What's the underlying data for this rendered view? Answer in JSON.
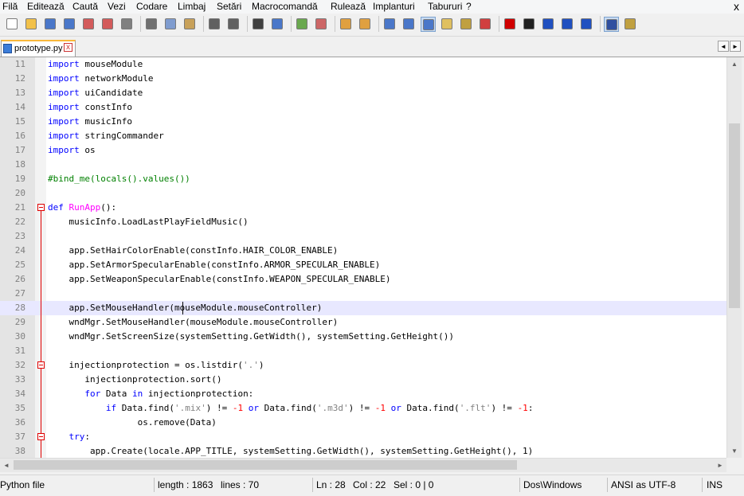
{
  "menu": [
    "Filă",
    "Editează",
    "Caută",
    "Vezi",
    "Codare",
    "Limbaj",
    "Setări",
    "Macrocomandă",
    "Rulează",
    "Implanturi",
    "Tabururi",
    "?"
  ],
  "menu_close": "x",
  "toolbar": [
    {
      "name": "new-file-icon",
      "color": "#ffffff"
    },
    {
      "name": "open-file-icon",
      "color": "#f2c14a"
    },
    {
      "name": "save-icon",
      "color": "#4a77c9"
    },
    {
      "name": "save-all-icon",
      "color": "#4a77c9"
    },
    {
      "name": "close-file-icon",
      "color": "#d35b5b"
    },
    {
      "name": "close-all-icon",
      "color": "#d35b5b"
    },
    {
      "name": "print-icon",
      "color": "#808080"
    },
    {
      "name": "sep"
    },
    {
      "name": "cut-icon",
      "color": "#707070"
    },
    {
      "name": "copy-icon",
      "color": "#7f9ccf"
    },
    {
      "name": "paste-icon",
      "color": "#c8a15a"
    },
    {
      "name": "sep"
    },
    {
      "name": "undo-icon",
      "color": "#606060"
    },
    {
      "name": "redo-icon",
      "color": "#606060"
    },
    {
      "name": "sep"
    },
    {
      "name": "find-icon",
      "color": "#404040"
    },
    {
      "name": "replace-icon",
      "color": "#4a77c9"
    },
    {
      "name": "sep"
    },
    {
      "name": "zoom-in-icon",
      "color": "#6aa84f"
    },
    {
      "name": "zoom-out-icon",
      "color": "#cc6666"
    },
    {
      "name": "sep"
    },
    {
      "name": "sync-vertical-icon",
      "color": "#e0a040"
    },
    {
      "name": "sync-horizontal-icon",
      "color": "#e0a040"
    },
    {
      "name": "sep"
    },
    {
      "name": "word-wrap-icon",
      "color": "#4a77c9"
    },
    {
      "name": "show-all-chars-icon",
      "color": "#4a77c9"
    },
    {
      "name": "indent-guide-icon",
      "color": "#4a77c9",
      "active": true
    },
    {
      "name": "doc-map-icon",
      "color": "#e0c060"
    },
    {
      "name": "function-list-icon",
      "color": "#c0a040"
    },
    {
      "name": "folder-workspace-icon",
      "color": "#d04040"
    },
    {
      "name": "sep"
    },
    {
      "name": "record-macro-icon",
      "color": "#d00000"
    },
    {
      "name": "stop-macro-icon",
      "color": "#202020"
    },
    {
      "name": "play-macro-icon",
      "color": "#2050c0"
    },
    {
      "name": "play-multiple-icon",
      "color": "#2050c0"
    },
    {
      "name": "save-macro-icon",
      "color": "#2050c0"
    },
    {
      "name": "sep"
    },
    {
      "name": "spellcheck-icon",
      "color": "#3050a0",
      "active": true
    },
    {
      "name": "plugin-icon",
      "color": "#c0a040"
    }
  ],
  "tab": {
    "label": "prototype.py",
    "close": "x"
  },
  "tab_arrows": [
    "◄",
    "►"
  ],
  "editor": {
    "lines": [
      {
        "n": "11",
        "segs": [
          {
            "c": "kw2",
            "t": "import"
          },
          {
            "c": "",
            "t": " mouseModule"
          }
        ]
      },
      {
        "n": "12",
        "segs": [
          {
            "c": "kw2",
            "t": "import"
          },
          {
            "c": "",
            "t": " networkModule"
          }
        ]
      },
      {
        "n": "13",
        "segs": [
          {
            "c": "kw2",
            "t": "import"
          },
          {
            "c": "",
            "t": " uiCandidate"
          }
        ]
      },
      {
        "n": "14",
        "segs": [
          {
            "c": "kw2",
            "t": "import"
          },
          {
            "c": "",
            "t": " constInfo"
          }
        ]
      },
      {
        "n": "15",
        "segs": [
          {
            "c": "kw2",
            "t": "import"
          },
          {
            "c": "",
            "t": " musicInfo"
          }
        ]
      },
      {
        "n": "16",
        "segs": [
          {
            "c": "kw2",
            "t": "import"
          },
          {
            "c": "",
            "t": " stringCommander"
          }
        ]
      },
      {
        "n": "17",
        "segs": [
          {
            "c": "kw2",
            "t": "import"
          },
          {
            "c": "",
            "t": " os"
          }
        ]
      },
      {
        "n": "18",
        "segs": []
      },
      {
        "n": "19",
        "segs": [
          {
            "c": "cm",
            "t": "#bind_me(locals().values())"
          }
        ]
      },
      {
        "n": "20",
        "segs": []
      },
      {
        "n": "21",
        "segs": [
          {
            "c": "kw2",
            "t": "def"
          },
          {
            "c": "",
            "t": " "
          },
          {
            "c": "fn",
            "t": "RunApp"
          },
          {
            "c": "",
            "t": "():"
          }
        ]
      },
      {
        "n": "22",
        "segs": [
          {
            "c": "",
            "t": "    musicInfo.LoadLastPlayFieldMusic()"
          }
        ]
      },
      {
        "n": "23",
        "segs": []
      },
      {
        "n": "24",
        "segs": [
          {
            "c": "",
            "t": "    app.SetHairColorEnable(constInfo.HAIR_COLOR_ENABLE)"
          }
        ]
      },
      {
        "n": "25",
        "segs": [
          {
            "c": "",
            "t": "    app.SetArmorSpecularEnable(constInfo.ARMOR_SPECULAR_ENABLE)"
          }
        ]
      },
      {
        "n": "26",
        "segs": [
          {
            "c": "",
            "t": "    app.SetWeaponSpecularEnable(constInfo.WEAPON_SPECULAR_ENABLE)"
          }
        ]
      },
      {
        "n": "27",
        "segs": []
      },
      {
        "n": "28",
        "segs": [
          {
            "c": "",
            "t": "    app.SetMouseHandler(mouseModule.mouseController)"
          }
        ]
      },
      {
        "n": "29",
        "segs": [
          {
            "c": "",
            "t": "    wndMgr.SetMouseHandler(mouseModule.mouseController)"
          }
        ]
      },
      {
        "n": "30",
        "segs": [
          {
            "c": "",
            "t": "    wndMgr.SetScreenSize(systemSetting.GetWidth(), systemSetting.GetHeight())"
          }
        ]
      },
      {
        "n": "31",
        "segs": []
      },
      {
        "n": "32",
        "segs": [
          {
            "c": "",
            "t": "    injectionprotection = os.listdir("
          },
          {
            "c": "st",
            "t": "'.'"
          },
          {
            "c": "",
            "t": ")"
          }
        ]
      },
      {
        "n": "33",
        "segs": [
          {
            "c": "",
            "t": "       injectionprotection.sort()"
          }
        ]
      },
      {
        "n": "34",
        "segs": [
          {
            "c": "",
            "t": "       "
          },
          {
            "c": "kw2",
            "t": "for"
          },
          {
            "c": "",
            "t": " Data "
          },
          {
            "c": "kw2",
            "t": "in"
          },
          {
            "c": "",
            "t": " injectionprotection:"
          }
        ]
      },
      {
        "n": "35",
        "segs": [
          {
            "c": "",
            "t": "           "
          },
          {
            "c": "kw2",
            "t": "if"
          },
          {
            "c": "",
            "t": " Data.find("
          },
          {
            "c": "st",
            "t": "'.mix'"
          },
          {
            "c": "",
            "t": ") != "
          },
          {
            "c": "nm",
            "t": "-1"
          },
          {
            "c": "",
            "t": " "
          },
          {
            "c": "kw2",
            "t": "or"
          },
          {
            "c": "",
            "t": " Data.find("
          },
          {
            "c": "st",
            "t": "'.m3d'"
          },
          {
            "c": "",
            "t": ") != "
          },
          {
            "c": "nm",
            "t": "-1"
          },
          {
            "c": "",
            "t": " "
          },
          {
            "c": "kw2",
            "t": "or"
          },
          {
            "c": "",
            "t": " Data.find("
          },
          {
            "c": "st",
            "t": "'.flt'"
          },
          {
            "c": "",
            "t": ") != "
          },
          {
            "c": "nm",
            "t": "-1"
          },
          {
            "c": "",
            "t": ":"
          }
        ]
      },
      {
        "n": "36",
        "segs": [
          {
            "c": "",
            "t": "                 os.remove(Data)"
          }
        ]
      },
      {
        "n": "37",
        "segs": [
          {
            "c": "",
            "t": "    "
          },
          {
            "c": "kw2",
            "t": "try"
          },
          {
            "c": "",
            "t": ":"
          }
        ]
      },
      {
        "n": "38",
        "segs": [
          {
            "c": "",
            "t": "        app.Create(locale.APP_TITLE, systemSetting.GetWidth(), systemSetting.GetHeight(), 1)"
          }
        ]
      }
    ],
    "current_line": "28"
  },
  "status": {
    "language": "Python file",
    "length": "length : 1863",
    "lines": "lines : 70",
    "ln": "Ln : 28",
    "col": "Col : 22",
    "sel": "Sel : 0 | 0",
    "eol": "Dos\\Windows",
    "encoding": "ANSI as UTF-8",
    "mode": "INS"
  }
}
